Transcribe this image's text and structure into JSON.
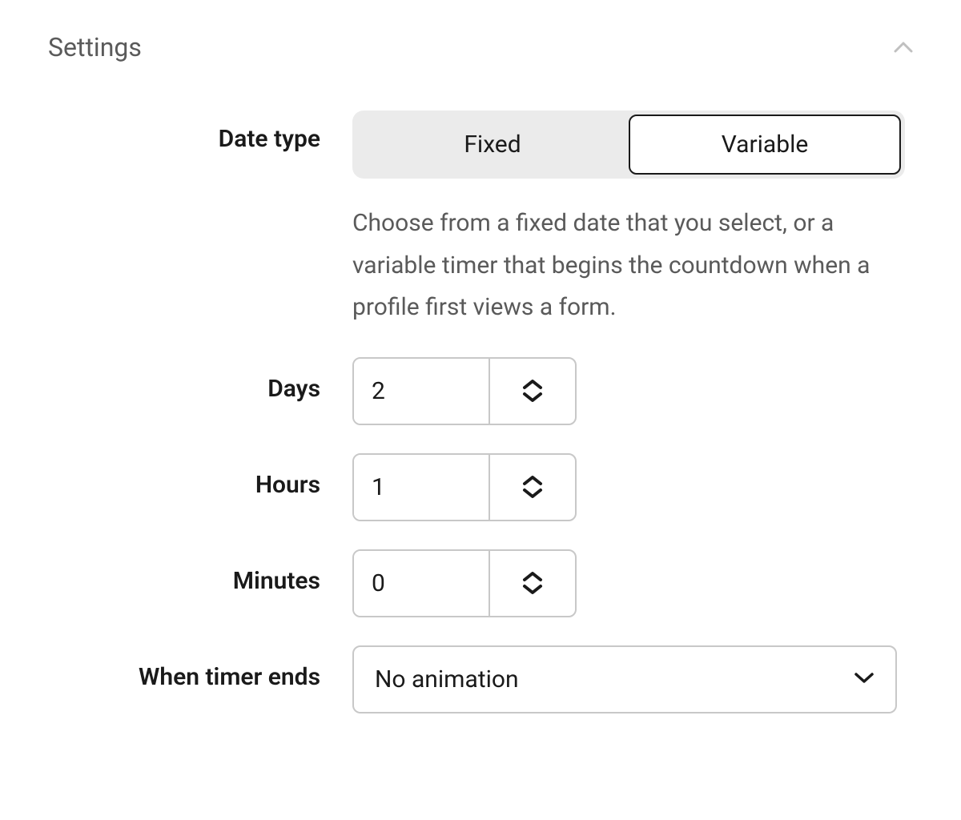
{
  "header": {
    "title": "Settings"
  },
  "dateType": {
    "label": "Date type",
    "options": {
      "fixed": "Fixed",
      "variable": "Variable"
    },
    "helpText": "Choose from a fixed date that you select, or a variable timer that begins the countdown when a profile first views a form."
  },
  "days": {
    "label": "Days",
    "value": "2"
  },
  "hours": {
    "label": "Hours",
    "value": "1"
  },
  "minutes": {
    "label": "Minutes",
    "value": "0"
  },
  "whenTimerEnds": {
    "label": "When timer ends",
    "value": "No animation"
  }
}
